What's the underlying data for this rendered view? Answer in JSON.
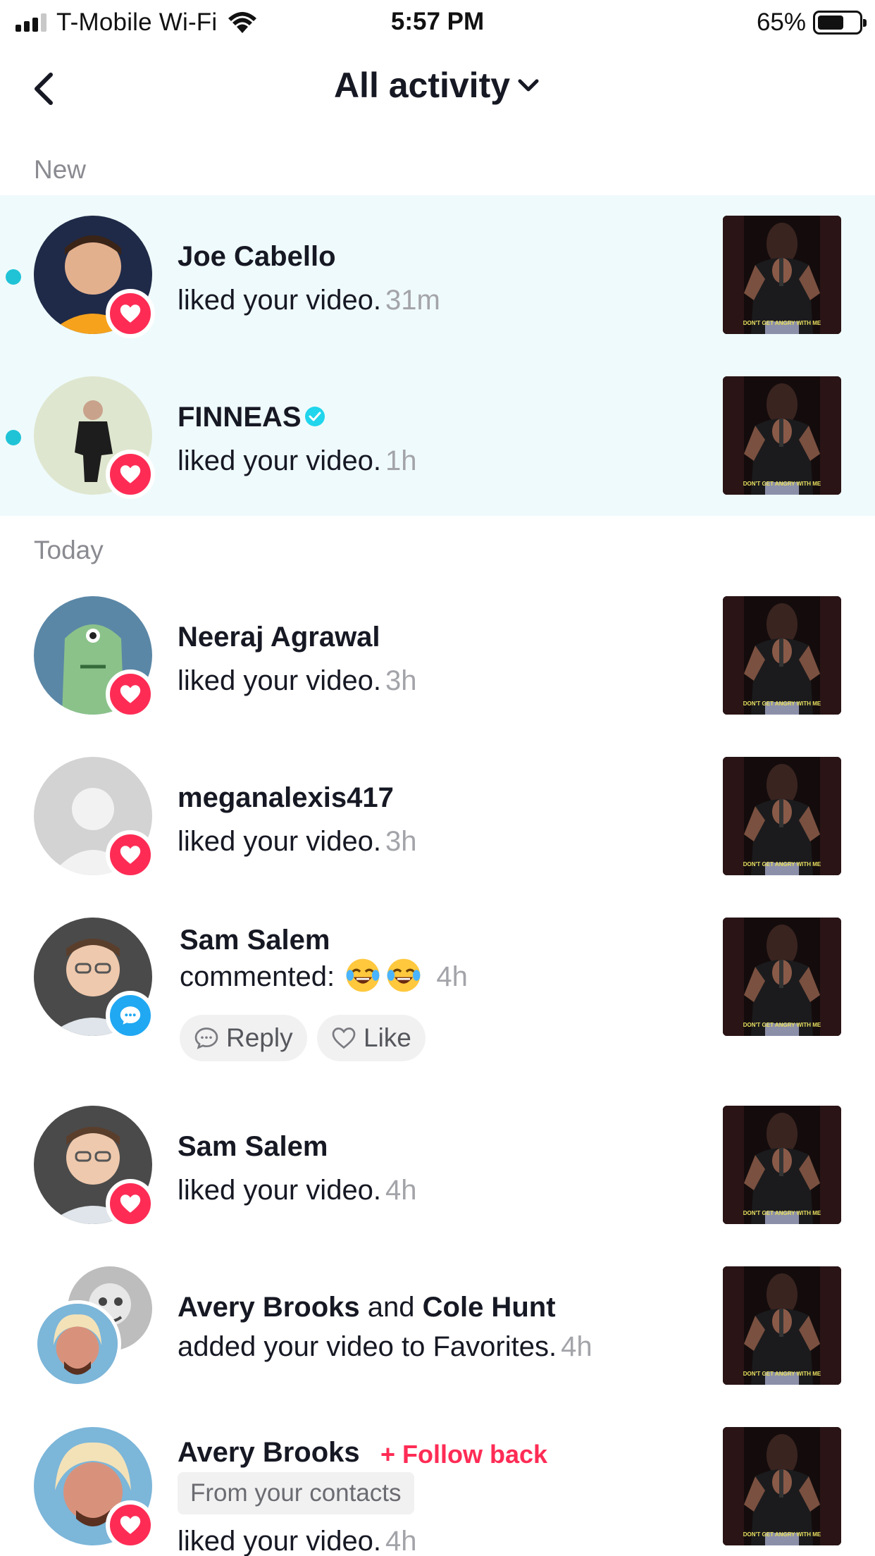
{
  "status_bar": {
    "carrier": "T-Mobile Wi-Fi",
    "time": "5:57 PM",
    "battery_percent": "65%",
    "battery_level": 0.65,
    "signal_bars": 3
  },
  "header": {
    "title": "All activity",
    "back_icon": "chevron-left-icon",
    "dropdown_icon": "chevron-down-icon"
  },
  "sections": {
    "new_label": "New",
    "today_label": "Today"
  },
  "colors": {
    "accent_red": "#fe2c55",
    "unread_dot": "#20c3d6",
    "new_bg": "#effafc",
    "comment_badge": "#20a8f2"
  },
  "notifications": [
    {
      "name": "Joe Cabello",
      "action": "liked your video.",
      "time": "31m",
      "badge": "heart-icon",
      "unread": true
    },
    {
      "name": "FINNEAS",
      "verified": true,
      "action": "liked your video.",
      "time": "1h",
      "badge": "heart-icon",
      "unread": true
    },
    {
      "name": "Neeraj Agrawal",
      "action": "liked your video.",
      "time": "3h",
      "badge": "heart-icon"
    },
    {
      "name": "meganalexis417",
      "action": "liked your video.",
      "time": "3h",
      "badge": "heart-icon"
    },
    {
      "name": "Sam Salem",
      "action": "commented:",
      "comment_emoji": "😂😂",
      "time": "4h",
      "badge": "comment-icon",
      "reply_label": "Reply",
      "like_label": "Like"
    },
    {
      "name": "Sam Salem",
      "action": "liked your video.",
      "time": "4h",
      "badge": "heart-icon"
    },
    {
      "name": "Avery Brooks",
      "connector": "and",
      "name2": "Cole Hunt",
      "action": "added your video to Favorites.",
      "time": "4h"
    },
    {
      "name": "Avery Brooks",
      "follow_back": "+ Follow back",
      "tag": "From your contacts",
      "action": "liked your video.",
      "time": "4h",
      "badge": "heart-icon"
    }
  ],
  "thumbnail_caption": "DON'T GET ANGRY WITH ME"
}
